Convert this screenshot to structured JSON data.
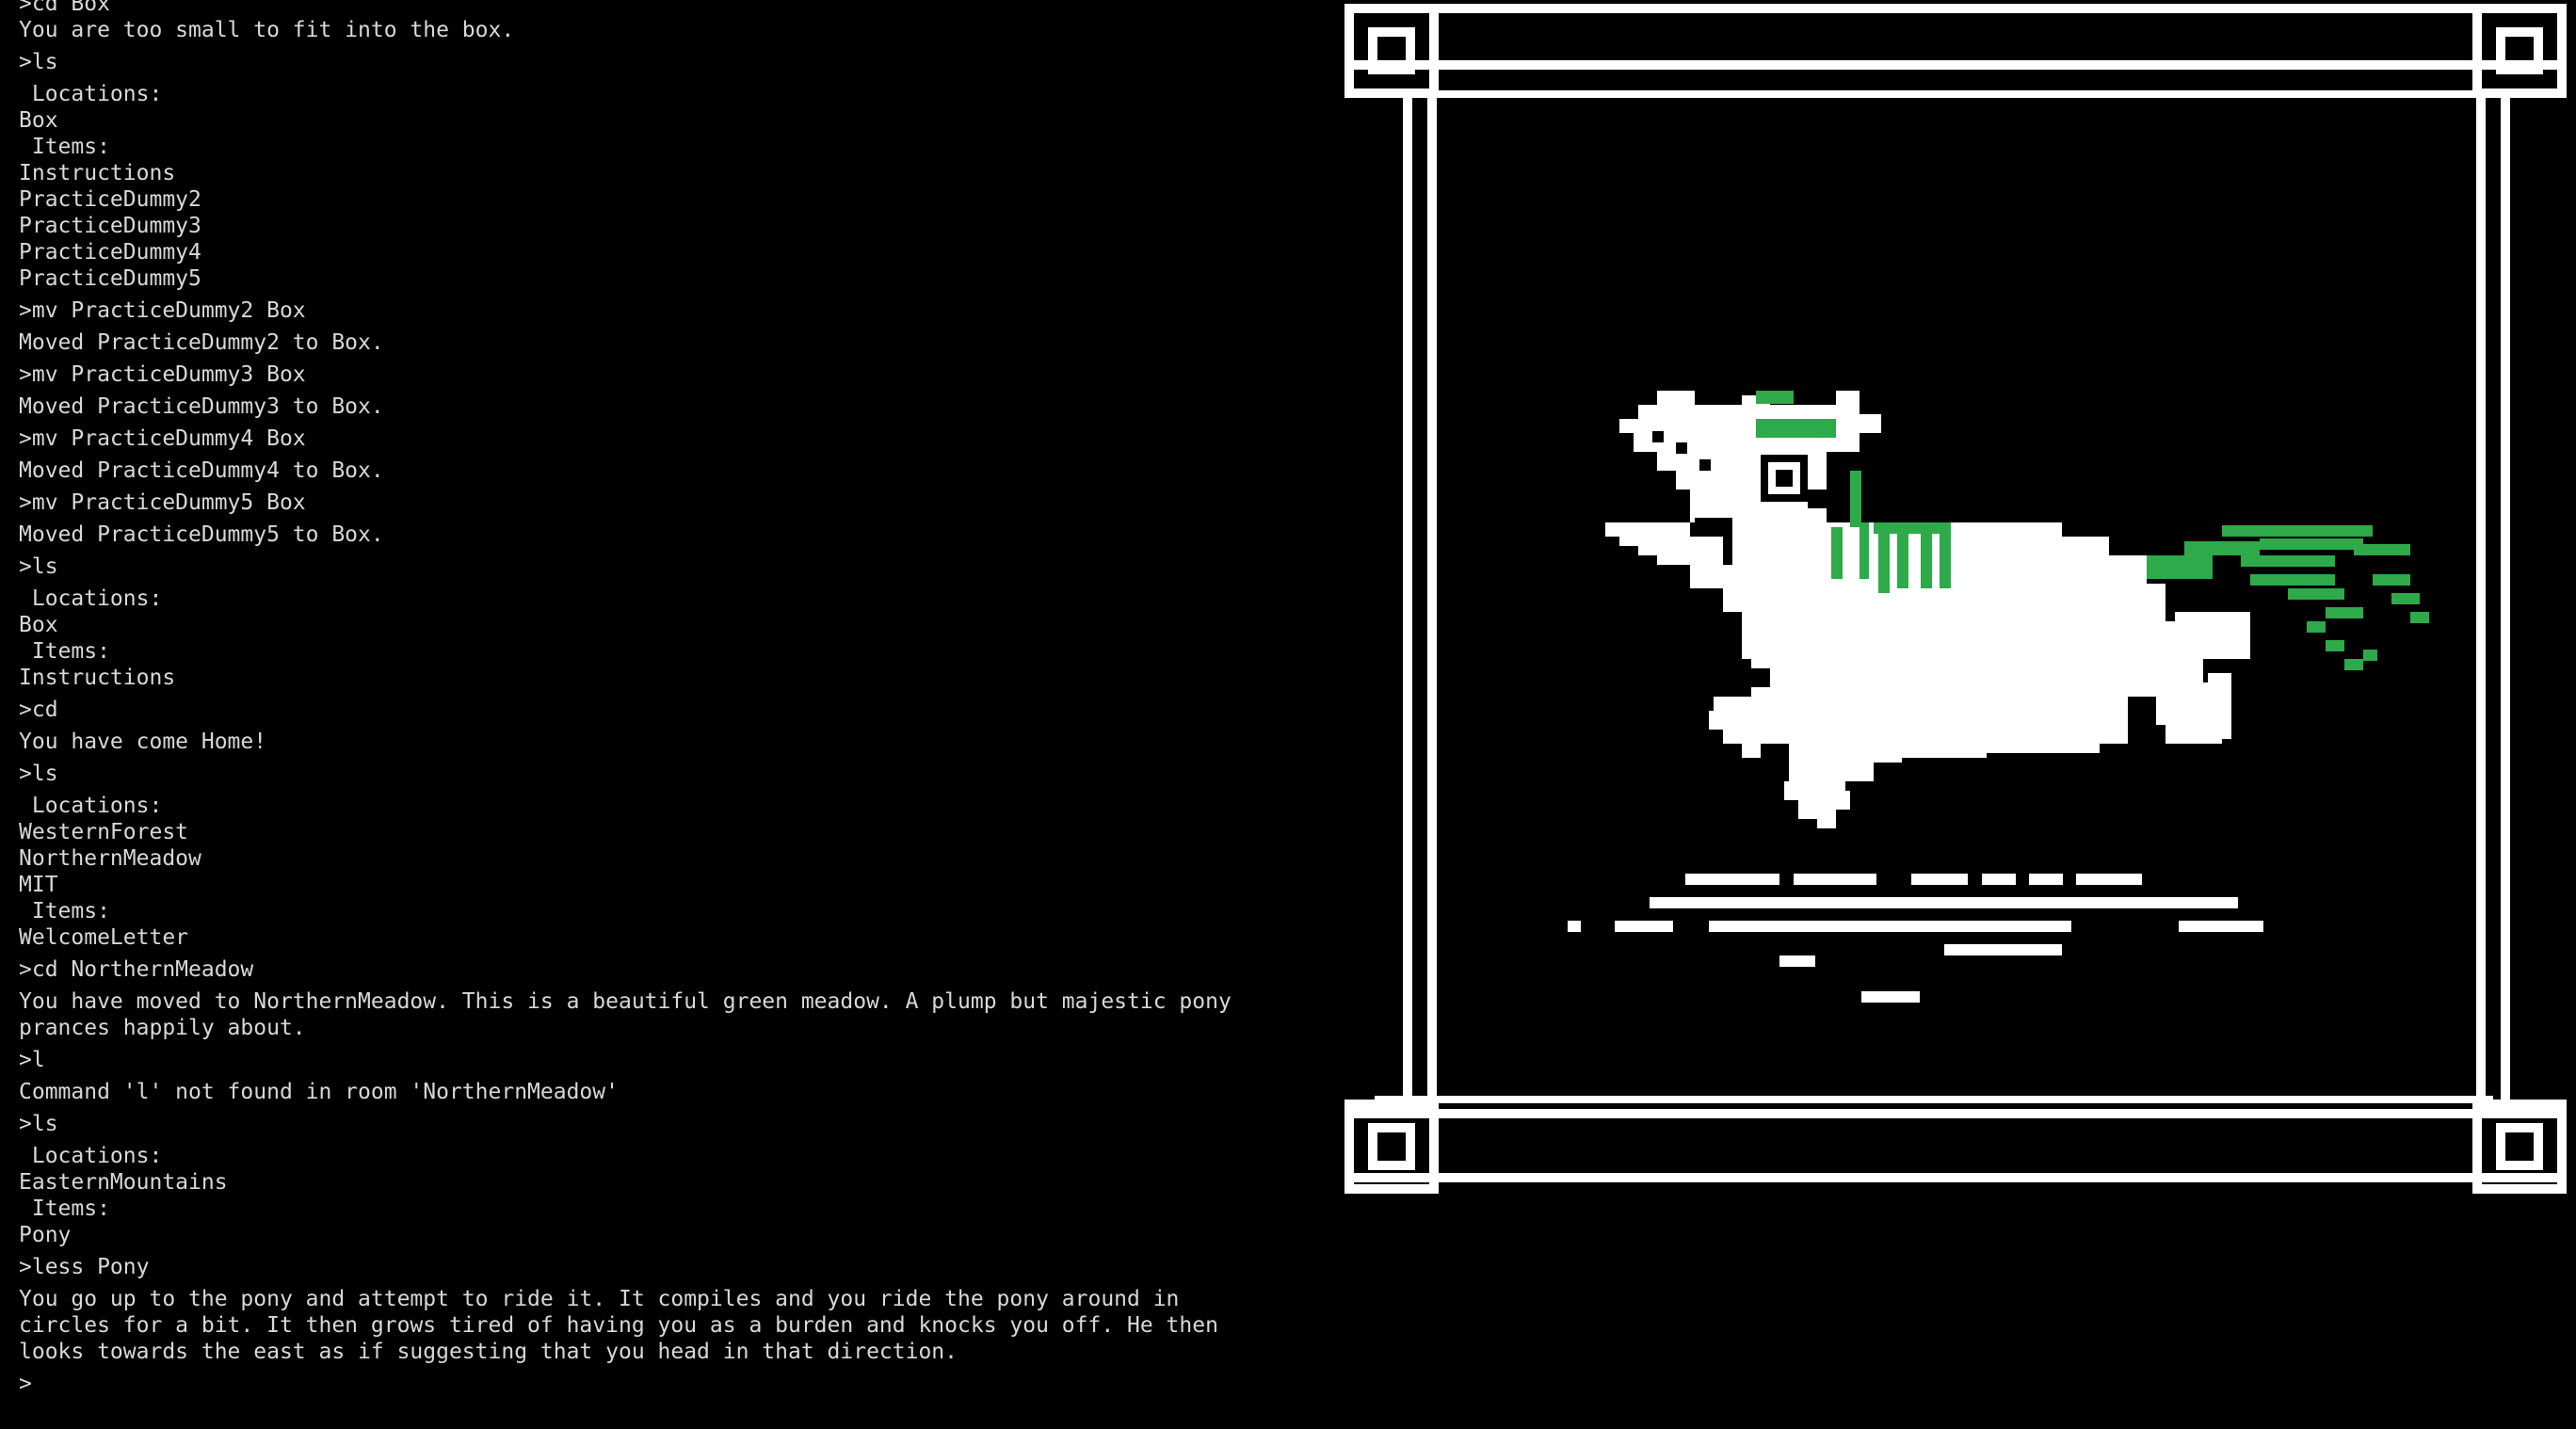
{
  "terminal": {
    "prompt": ">",
    "lines": [
      ">cd Box",
      "You are too small to fit into the box.",
      ">ls",
      " Locations:",
      "Box",
      " Items:",
      "Instructions",
      "PracticeDummy2",
      "PracticeDummy3",
      "PracticeDummy4",
      "PracticeDummy5",
      ">mv PracticeDummy2 Box",
      "Moved PracticeDummy2 to Box.",
      ">mv PracticeDummy3 Box",
      "Moved PracticeDummy3 to Box.",
      ">mv PracticeDummy4 Box",
      "Moved PracticeDummy4 to Box.",
      ">mv PracticeDummy5 Box",
      "Moved PracticeDummy5 to Box.",
      ">ls",
      " Locations:",
      "Box",
      " Items:",
      "Instructions",
      ">cd",
      "You have come Home!",
      ">ls",
      " Locations:",
      "WesternForest",
      "NorthernMeadow",
      "MIT",
      " Items:",
      "WelcomeLetter",
      ">cd NorthernMeadow",
      "You have moved to NorthernMeadow. This is a beautiful green meadow. A plump but majestic pony",
      "prances happily about.",
      ">l",
      "Command 'l' not found in room 'NorthernMeadow'",
      ">ls",
      " Locations:",
      "EasternMountains",
      " Items:",
      "Pony",
      ">less Pony",
      "You go up to the pony and attempt to ride it. It compiles and you ride the pony around in",
      "circles for a bit. It then grows tired of having you as a burden and knocks you off. He then",
      "looks towards the east as if suggesting that you head in that direction."
    ]
  },
  "colors": {
    "background": "#000000",
    "text": "#d8d8d8",
    "frame": "#ffffff",
    "pony_body": "#ffffff",
    "pony_mane": "#2eaa4a"
  },
  "scene": {
    "icon": "pony-icon",
    "frame_icon": "greek-key-frame-icon"
  }
}
